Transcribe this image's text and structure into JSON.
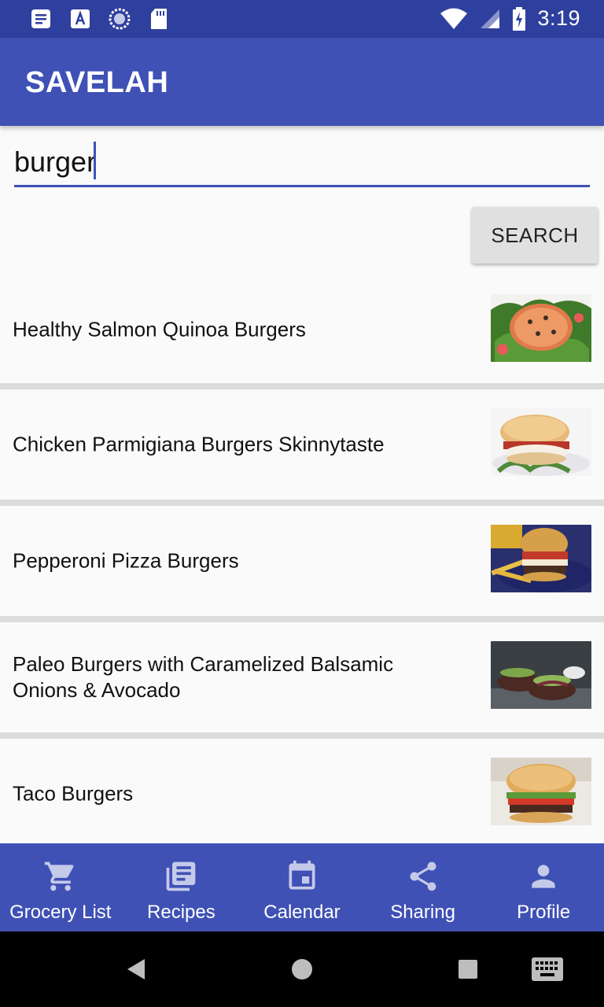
{
  "status_bar": {
    "time": "3:19",
    "icons": [
      "notes-icon",
      "font-a-icon",
      "loading-circle-icon",
      "sd-card-icon",
      "wifi-icon",
      "signal-icon",
      "battery-charging-icon"
    ]
  },
  "app_bar": {
    "title": "SAVELAH"
  },
  "search": {
    "value": "burger",
    "button_label": "SEARCH"
  },
  "results": [
    {
      "title": "Healthy Salmon Quinoa Burgers",
      "image": "salmon-patty-on-greens"
    },
    {
      "title": "Chicken Parmigiana Burgers Skinnytaste",
      "image": "chicken-parm-burger"
    },
    {
      "title": "Pepperoni Pizza Burgers",
      "image": "pizza-burger-with-fries"
    },
    {
      "title": "Paleo Burgers with Caramelized Balsamic Onions & Avocado",
      "image": "paleo-burgers-avocado"
    },
    {
      "title": "Taco Burgers",
      "image": "taco-burger"
    }
  ],
  "bottom_nav": [
    {
      "label": "Grocery List",
      "icon": "cart-icon"
    },
    {
      "label": "Recipes",
      "icon": "recipes-icon"
    },
    {
      "label": "Calendar",
      "icon": "calendar-icon"
    },
    {
      "label": "Sharing",
      "icon": "share-icon"
    },
    {
      "label": "Profile",
      "icon": "profile-icon"
    }
  ],
  "colors": {
    "primary": "#3f51b5",
    "primary_dark": "#2f3f9e",
    "button": "#e0e0e0",
    "divider": "#dcdcdc"
  }
}
